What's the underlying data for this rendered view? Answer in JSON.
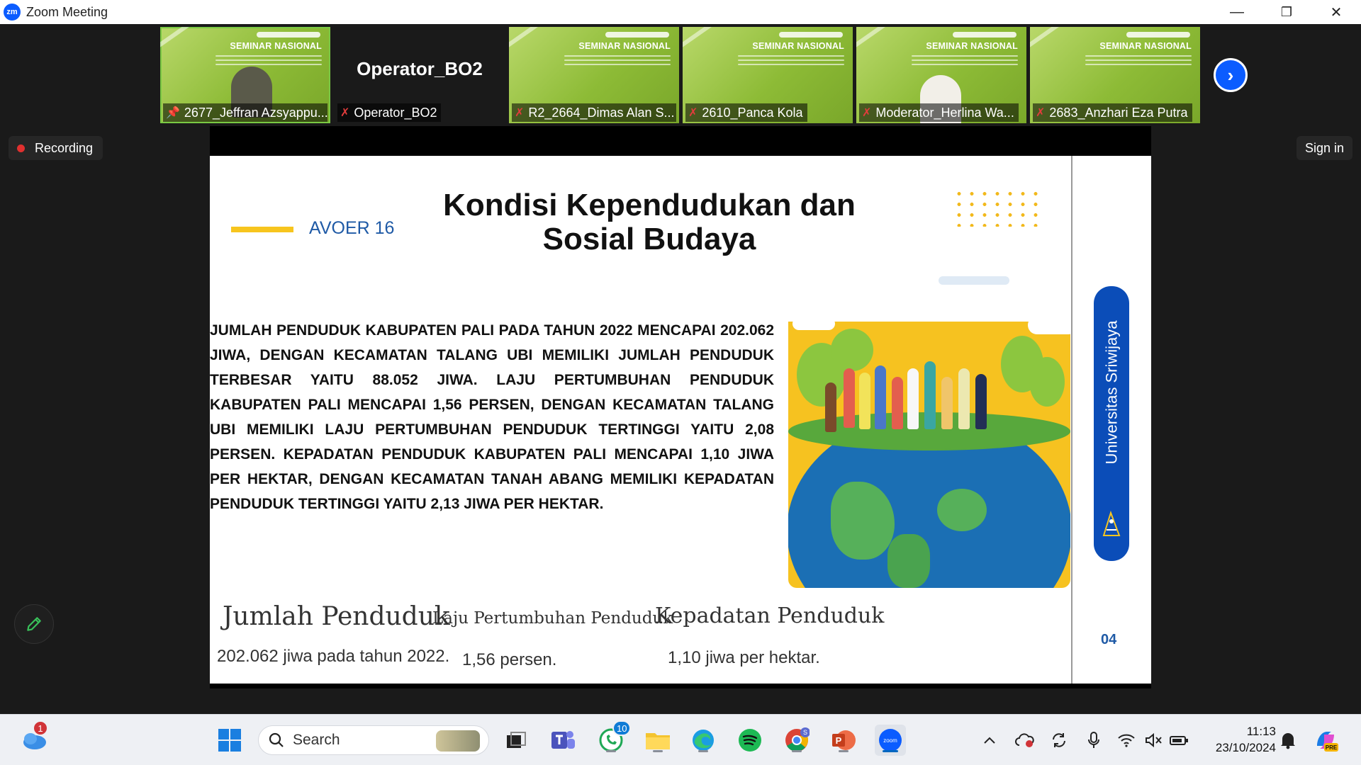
{
  "window": {
    "title": "Zoom Meeting",
    "logo": "zm",
    "minimize": "—",
    "maximize": "❐",
    "close": "✕"
  },
  "participants": [
    {
      "name": "2677_Jeffran Azsyappu...",
      "video": true,
      "pinned": true
    },
    {
      "name": "Operator_BO2",
      "video": false,
      "display_name": "Operator_BO2",
      "muted": true
    },
    {
      "name": "R2_2664_Dimas Alan S...",
      "video": true,
      "muted": true
    },
    {
      "name": "2610_Panca Kola",
      "video": true,
      "muted": true
    },
    {
      "name": "Moderator_Herlina Wa...",
      "video": true,
      "muted": true
    },
    {
      "name": "2683_Anzhari Eza Putra",
      "video": true,
      "muted": true
    }
  ],
  "participant_background_heading": "SEMINAR NASIONAL",
  "recording": {
    "label": "Recording"
  },
  "sign_in": {
    "label": "Sign in"
  },
  "slide": {
    "tag": "AVOER 16",
    "title_line1": "Kondisi Kependudukan dan",
    "title_line2": "Sosial Budaya",
    "paragraph": "JUMLAH PENDUDUK KABUPATEN PALI PADA TAHUN 2022 MENCAPAI 202.062 JIWA, DENGAN KECAMATAN TALANG UBI MEMILIKI JUMLAH PENDUDUK TERBESAR YAITU 88.052 JIWA. LAJU PERTUMBUHAN PENDUDUK KABUPATEN PALI MENCAPAI 1,56 PERSEN, DENGAN KECAMATAN TALANG UBI MEMILIKI LAJU PERTUMBUHAN PENDUDUK TERTINGGI YAITU 2,08 PERSEN. KEPADATAN PENDUDUK KABUPATEN PALI MENCAPAI 1,10 JIWA PER HEKTAR, DENGAN KECAMATAN TANAH ABANG MEMILIKI KEPADATAN PENDUDUK TERTINGGI YAITU 2,13 JIWA PER HEKTAR.",
    "stats": [
      {
        "label": "Jumlah Penduduk",
        "value": "202.062 jiwa pada tahun 2022."
      },
      {
        "label": "Laju Pertumbuhan Penduduk",
        "value": "1,56 persen."
      },
      {
        "label": "Kepadatan Penduduk",
        "value": "1,10 jiwa per hektar."
      }
    ],
    "university": "Universitas Sriwijaya",
    "page_number": "04",
    "colors": {
      "accent_yellow": "#f7c51e",
      "accent_blue": "#0b4db8"
    }
  },
  "taskbar": {
    "search_placeholder": "Search",
    "weather_badge": "1",
    "whatsapp_badge": "10",
    "clock_time": "11:13",
    "clock_date": "23/10/2024",
    "icons": [
      "onedrive-icon",
      "windows-start-icon",
      "search-icon",
      "task-view-icon",
      "teams-icon",
      "whatsapp-icon",
      "file-explorer-icon",
      "edge-icon",
      "spotify-icon",
      "chrome-icon",
      "powerpoint-icon",
      "zoom-icon",
      "chevron-up-icon",
      "cloud-offline-icon",
      "sync-icon",
      "microphone-icon",
      "wifi-icon",
      "volume-muted-icon",
      "battery-icon",
      "notification-bell-icon",
      "copilot-icon"
    ]
  }
}
